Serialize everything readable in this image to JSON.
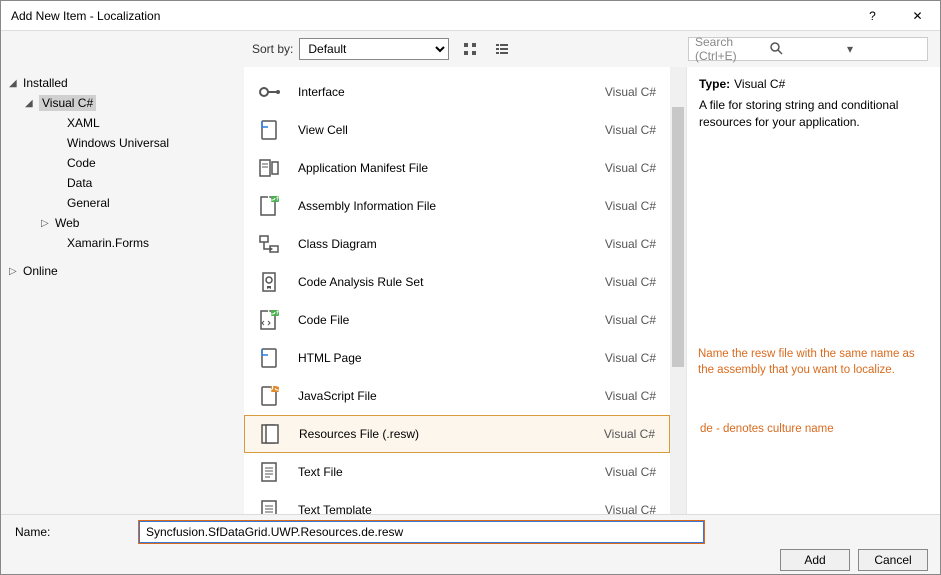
{
  "window": {
    "title": "Add New Item - Localization",
    "help": "?",
    "close": "✕"
  },
  "toolbar": {
    "sort_label": "Sort by:",
    "sort_value": "Default",
    "search_placeholder": "Search (Ctrl+E)"
  },
  "tree": {
    "installed": "Installed",
    "csharp": "Visual C#",
    "xaml": "XAML",
    "winuniversal": "Windows Universal",
    "code": "Code",
    "data": "Data",
    "general": "General",
    "web": "Web",
    "xamarin": "Xamarin.Forms",
    "online": "Online"
  },
  "items": [
    {
      "name": "Interface",
      "lang": "Visual C#",
      "icon": "interface"
    },
    {
      "name": "View Cell",
      "lang": "Visual C#",
      "icon": "page"
    },
    {
      "name": "Application Manifest File",
      "lang": "Visual C#",
      "icon": "manifest"
    },
    {
      "name": "Assembly Information File",
      "lang": "Visual C#",
      "icon": "asm"
    },
    {
      "name": "Class Diagram",
      "lang": "Visual C#",
      "icon": "diagram"
    },
    {
      "name": "Code Analysis Rule Set",
      "lang": "Visual C#",
      "icon": "ruleset"
    },
    {
      "name": "Code File",
      "lang": "Visual C#",
      "icon": "codefile"
    },
    {
      "name": "HTML Page",
      "lang": "Visual C#",
      "icon": "html"
    },
    {
      "name": "JavaScript File",
      "lang": "Visual C#",
      "icon": "js"
    },
    {
      "name": "Resources File (.resw)",
      "lang": "Visual C#",
      "icon": "resw",
      "selected": true
    },
    {
      "name": "Text File",
      "lang": "Visual C#",
      "icon": "text"
    },
    {
      "name": "Text Template",
      "lang": "Visual C#",
      "icon": "text"
    }
  ],
  "info": {
    "type_label": "Type:",
    "type_value": "Visual C#",
    "description": "A file for storing string and conditional resources for your application."
  },
  "callouts": {
    "c1": "Name the resw file with the same name as the assembly that you want to localize.",
    "c2": "de - denotes culture name"
  },
  "footer": {
    "name_label": "Name:",
    "name_value": "Syncfusion.SfDataGrid.UWP.Resources.de.resw",
    "add": "Add",
    "cancel": "Cancel"
  }
}
